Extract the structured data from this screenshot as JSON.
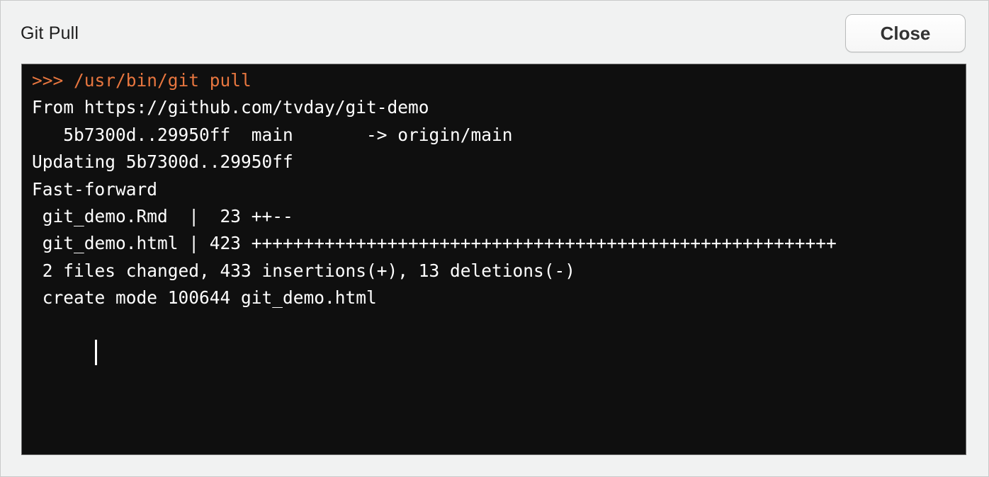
{
  "dialog": {
    "title": "Git Pull",
    "close_label": "Close"
  },
  "console": {
    "command": ">>> /usr/bin/git pull",
    "lines": [
      "From https://github.com/tvday/git-demo",
      "   5b7300d..29950ff  main       -> origin/main",
      "Updating 5b7300d..29950ff",
      "Fast-forward",
      " git_demo.Rmd  |  23 ++--",
      " git_demo.html | 423 ++++++++++++++++++++++++++++++++++++++++++++++++++++++++",
      " 2 files changed, 433 insertions(+), 13 deletions(-)",
      " create mode 100644 git_demo.html"
    ]
  },
  "colors": {
    "command_text": "#e7763f",
    "console_background": "#0f0f0f",
    "console_text": "#ffffff"
  }
}
